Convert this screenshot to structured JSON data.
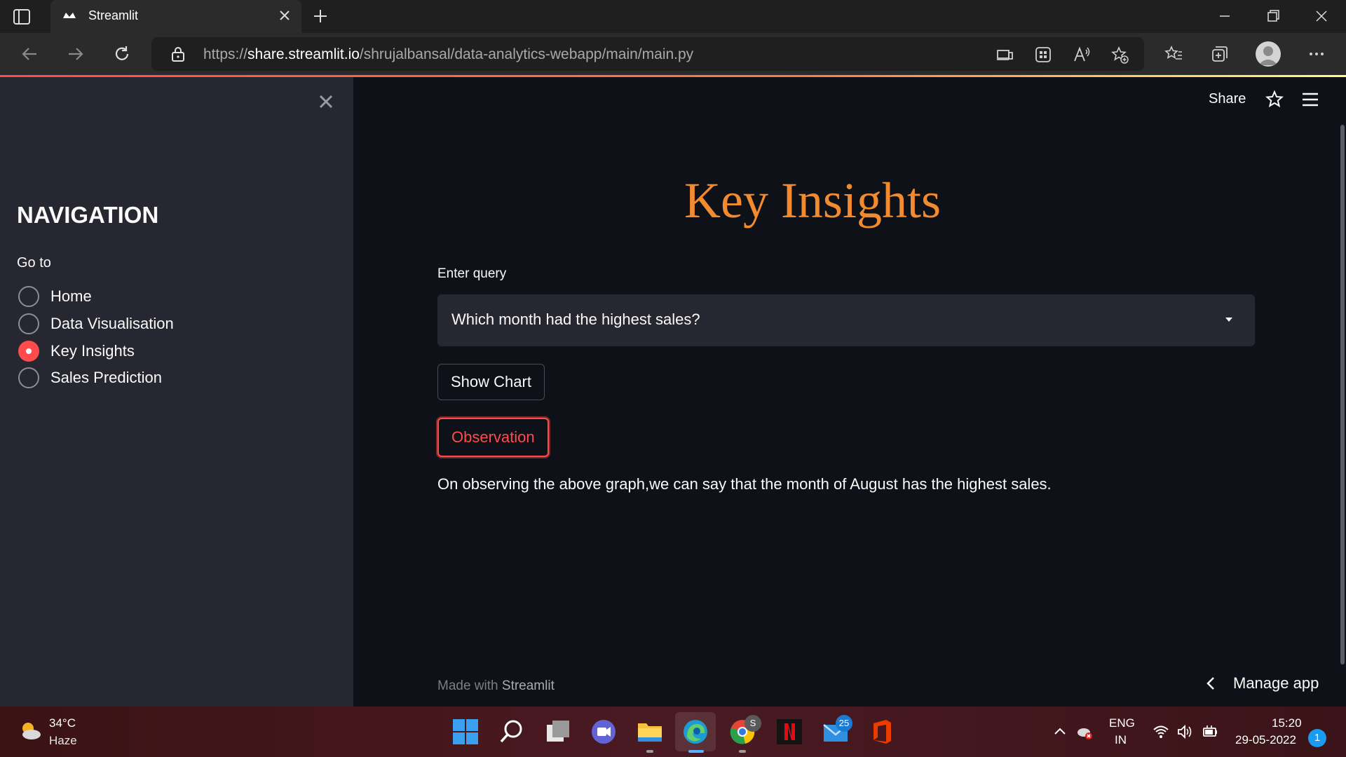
{
  "browser": {
    "tab_title": "Streamlit",
    "url_host": "share.streamlit.io",
    "url_prefix": "https://",
    "url_path": "/shrujalbansal/data-analytics-webapp/main/main.py"
  },
  "header": {
    "share_label": "Share"
  },
  "sidebar": {
    "title": "NAVIGATION",
    "radio_label": "Go to",
    "options": [
      {
        "label": "Home",
        "selected": false
      },
      {
        "label": "Data Visualisation",
        "selected": false
      },
      {
        "label": "Key Insights",
        "selected": true
      },
      {
        "label": "Sales Prediction",
        "selected": false
      }
    ]
  },
  "main": {
    "title": "Key Insights",
    "query_label": "Enter query",
    "query_value": "Which month had the highest sales?",
    "show_chart_label": "Show Chart",
    "observation_label": "Observation",
    "observation_text": "On observing the above graph,we can say that the month of August has the highest sales.",
    "footer_prefix": "Made with",
    "footer_brand": "Streamlit",
    "manage_label": "Manage app"
  },
  "taskbar": {
    "temperature": "34°C",
    "weather": "Haze",
    "mail_badge": "25",
    "chrome_badge": "S",
    "lang_1": "ENG",
    "lang_2": "IN",
    "time": "15:20",
    "date": "29-05-2022",
    "notifications": "1"
  },
  "colors": {
    "accent": "#ff4b4b",
    "title": "#f28b30",
    "background": "#0e1117",
    "sidebar": "#262730"
  }
}
